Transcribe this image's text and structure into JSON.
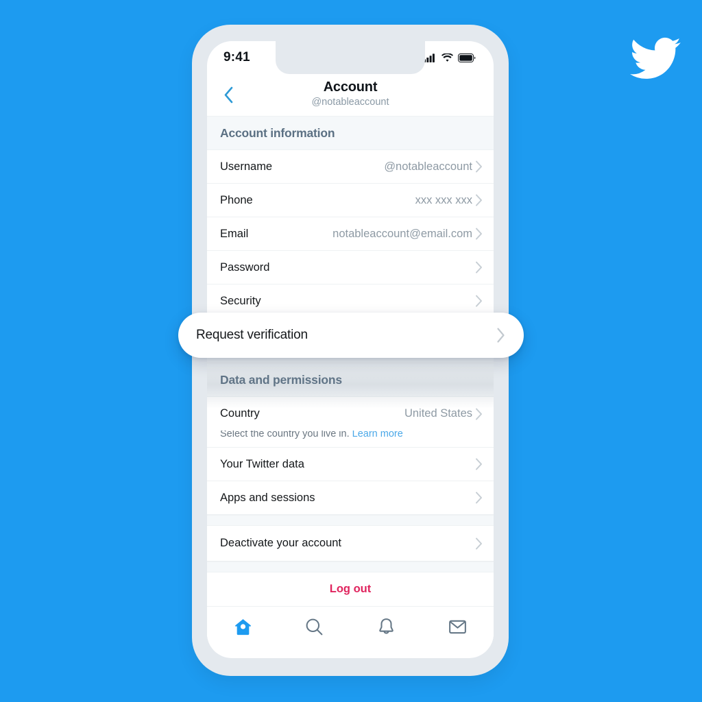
{
  "theme": {
    "background_color": "#1d9bf0",
    "accent_color": "#1d9bf0",
    "device_color": "#e4e9ee",
    "section_bg": "#f5f8fa",
    "section_text": "#5b7083",
    "logout_color": "#e0245e",
    "link_color": "#4aa8e8"
  },
  "brand": {
    "logo": "twitter-bird-icon"
  },
  "status_bar": {
    "time": "9:41",
    "icons": [
      "cellular-signal-icon",
      "wifi-icon",
      "battery-icon"
    ]
  },
  "nav": {
    "back_icon": "chevron-left-icon",
    "title": "Account",
    "subtitle": "@notableaccount"
  },
  "sections": [
    {
      "header": "Account information",
      "rows": [
        {
          "label": "Username",
          "value": "@notableaccount",
          "chevron": true
        },
        {
          "label": "Phone",
          "value": "xxx xxx xxx",
          "chevron": true
        },
        {
          "label": "Email",
          "value": "notableaccount@email.com",
          "chevron": true
        },
        {
          "label": "Password",
          "value": "",
          "chevron": true
        },
        {
          "label": "Security",
          "value": "",
          "chevron": true
        }
      ]
    },
    {
      "header": "Data and permissions",
      "rows": [
        {
          "label": "Country",
          "value": "United States",
          "chevron": true,
          "sub_text": "Select the country you live in.",
          "sub_link": "Learn more"
        },
        {
          "label": "Your Twitter data",
          "value": "",
          "chevron": true
        },
        {
          "label": "Apps and sessions",
          "value": "",
          "chevron": true
        }
      ]
    },
    {
      "header": "",
      "rows": [
        {
          "label": "Deactivate your account",
          "value": "",
          "chevron": true
        }
      ]
    }
  ],
  "highlight_card": {
    "label": "Request verification",
    "chevron_icon": "chevron-right-icon"
  },
  "logout": {
    "label": "Log out"
  },
  "tab_bar": {
    "items": [
      {
        "icon": "home-icon",
        "active": true
      },
      {
        "icon": "search-icon",
        "active": false
      },
      {
        "icon": "bell-icon",
        "active": false
      },
      {
        "icon": "envelope-icon",
        "active": false
      }
    ]
  }
}
